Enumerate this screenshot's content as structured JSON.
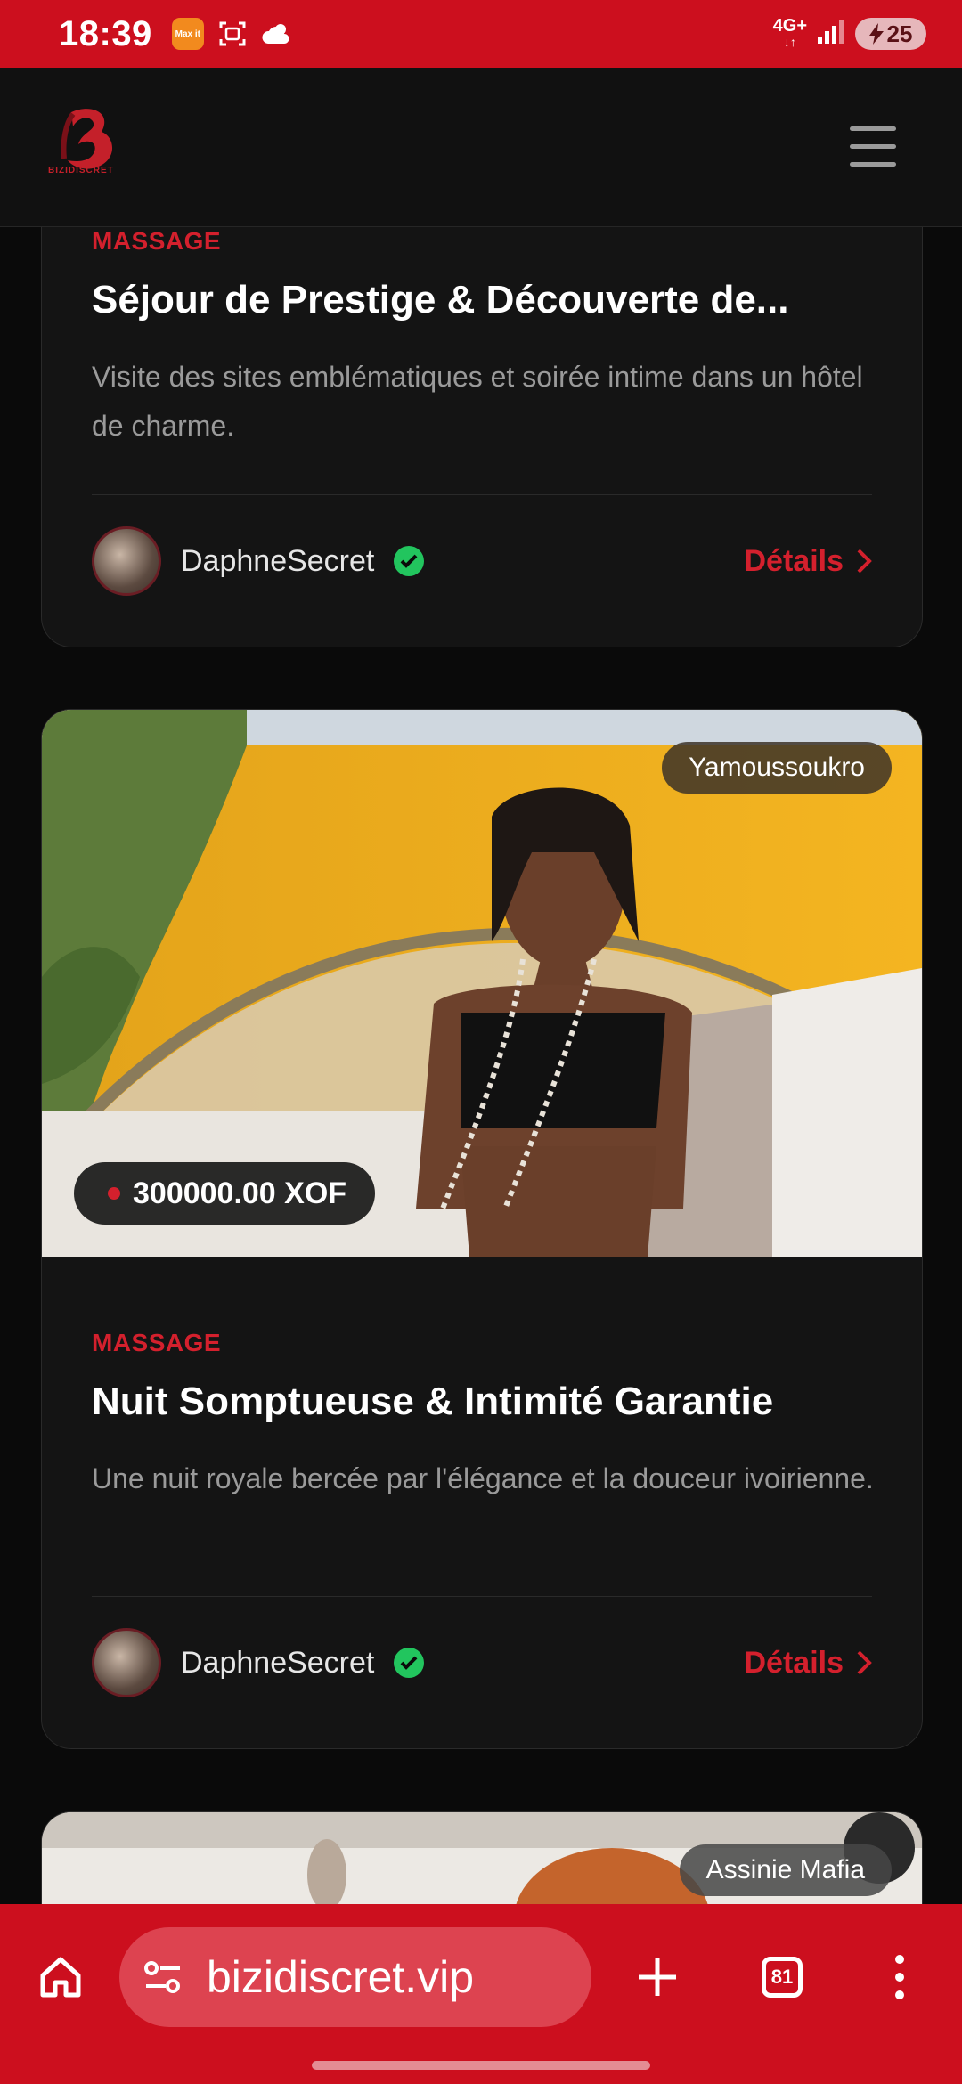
{
  "status_bar": {
    "time": "18:39",
    "app_icon_label": "Max it",
    "network": "4G+",
    "battery": "25"
  },
  "header": {
    "logo_text": "BIZIDISCRET"
  },
  "cards": [
    {
      "category": "MASSAGE",
      "title": "Séjour de Prestige & Découverte de...",
      "description": "Visite des sites emblématiques et soirée intime dans un hôtel de charme.",
      "author": "DaphneSecret",
      "details_label": "Détails"
    },
    {
      "city": "Yamoussoukro",
      "price": "300000.00 XOF",
      "category": "MASSAGE",
      "title": "Nuit Somptueuse & Intimité Garantie",
      "description": "Une nuit royale bercée par l'élégance et la douceur ivoirienne.",
      "author": "DaphneSecret",
      "details_label": "Détails"
    },
    {
      "city": "Assinie Mafia"
    }
  ],
  "browser": {
    "url": "bizidiscret.vip",
    "tab_count": "81"
  },
  "colors": {
    "accent": "#d4202d",
    "chrome": "#cc0f1e",
    "verified": "#22c55e"
  }
}
